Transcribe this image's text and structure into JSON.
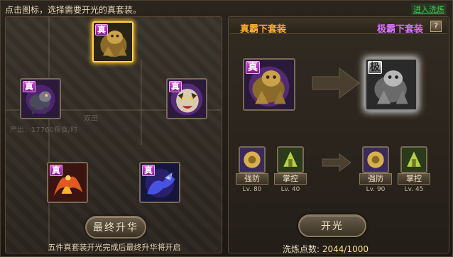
{
  "header": {
    "hint": "点击图标，选择需要开光的真套装。",
    "link_label": "进入洗炼"
  },
  "left": {
    "slots": [
      {
        "name": "slot-top",
        "tag": "真",
        "selected": true
      },
      {
        "name": "slot-left",
        "tag": "真",
        "selected": false
      },
      {
        "name": "slot-right",
        "tag": "真",
        "selected": false
      },
      {
        "name": "slot-bottom-left",
        "tag": "真",
        "selected": false
      },
      {
        "name": "slot-bottom-right",
        "tag": "真",
        "selected": false
      }
    ],
    "button_label": "最终升华",
    "note": "五件真套装开光完成后最终升华将开启",
    "map_texts": [
      "双田",
      "产出：17760粮食/时"
    ]
  },
  "right": {
    "title_current": "真霸下套装",
    "title_target": "极霸下套装",
    "help": "?",
    "current_tag": "真",
    "target_tag": "极",
    "skills_current": [
      {
        "name": "强防",
        "level": "Lv. 80"
      },
      {
        "name": "掌控",
        "level": "Lv. 40"
      }
    ],
    "skills_target": [
      {
        "name": "强防",
        "level": "Lv. 90"
      },
      {
        "name": "掌控",
        "level": "Lv. 45"
      }
    ],
    "button_label": "开光",
    "points_label": "洗炼点数:",
    "points_value": "2044/1000"
  },
  "colors": {
    "title_current": "#ffae2e",
    "title_target": "#d870ff",
    "selected_border": "#ffd24a",
    "link": "#35d35a"
  }
}
